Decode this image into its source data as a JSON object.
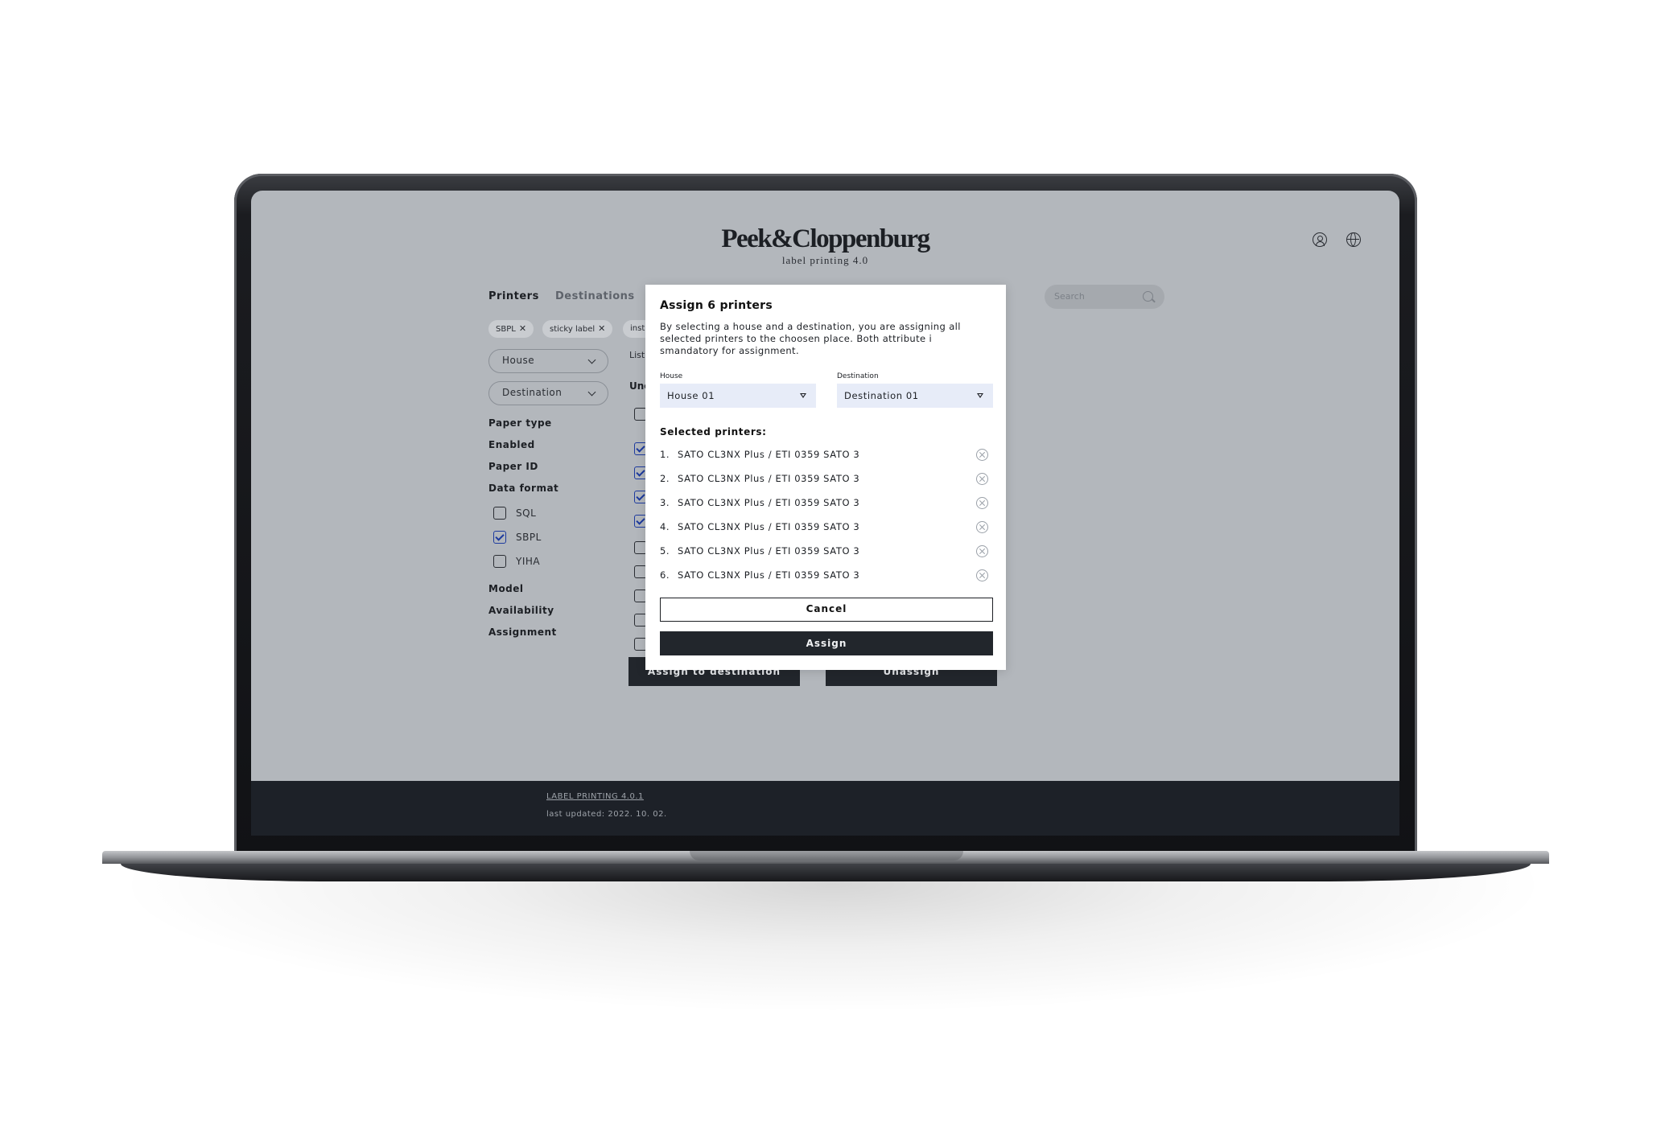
{
  "header": {
    "brand": "Peek&Cloppenburg",
    "subtitle": "label printing 4.0"
  },
  "top_icons": [
    "user-icon",
    "globe-icon"
  ],
  "tabs": [
    {
      "label": "Printers",
      "active": true
    },
    {
      "label": "Destinations",
      "active": false
    }
  ],
  "search": {
    "placeholder": "Search"
  },
  "chips": [
    {
      "label": "SBPL"
    },
    {
      "label": "sticky label"
    },
    {
      "label": "instr"
    }
  ],
  "dropdowns": {
    "house": "House",
    "destination": "Destination"
  },
  "filters": {
    "paper_type": "Paper type",
    "enabled": "Enabled",
    "paper_id": "Paper ID",
    "data_format": "Data format",
    "model": "Model",
    "availability": "Availability",
    "assignment": "Assignment"
  },
  "data_format_options": [
    {
      "label": "SQL",
      "checked": false
    },
    {
      "label": "SBPL",
      "checked": true
    },
    {
      "label": "YIHA",
      "checked": false
    }
  ],
  "list": {
    "fragment_label": "List",
    "fragment_heading": "Unc"
  },
  "row_checkboxes": [
    false,
    true,
    true,
    true,
    true,
    false,
    false,
    false,
    false,
    false
  ],
  "bottom_buttons": {
    "assign": "Assign to destination",
    "unassign": "Unassign"
  },
  "footer": {
    "version": "LABEL PRINTING 4.0.1",
    "updated": "last updated: 2022. 10. 02."
  },
  "modal": {
    "title": "Assign 6 printers",
    "description": "By selecting a house and a destination, you are assigning all selected printers to the choosen place. Both attribute i smandatory for assignment.",
    "house_label": "House",
    "house_value": "House 01",
    "destination_label": "Destination",
    "destination_value": "Destination 01",
    "selected_label": "Selected printers:",
    "printers": [
      {
        "num": "1.",
        "name": "SATO CL3NX Plus / ETI 0359 SATO 3"
      },
      {
        "num": "2.",
        "name": "SATO CL3NX Plus / ETI 0359 SATO 3"
      },
      {
        "num": "3.",
        "name": "SATO CL3NX Plus / ETI 0359 SATO 3"
      },
      {
        "num": "4.",
        "name": "SATO CL3NX Plus / ETI 0359 SATO 3"
      },
      {
        "num": "5.",
        "name": "SATO CL3NX Plus / ETI 0359 SATO 3"
      },
      {
        "num": "6.",
        "name": "SATO CL3NX Plus / ETI 0359 SATO 3"
      }
    ],
    "cancel_label": "Cancel",
    "assign_label": "Assign"
  },
  "colors": {
    "screen_bg": "#b3b7bc",
    "dark": "#22262c",
    "footer_bg": "#1d2128",
    "select_bg": "#e7ecf8",
    "check_accent": "#1d3a9e"
  }
}
